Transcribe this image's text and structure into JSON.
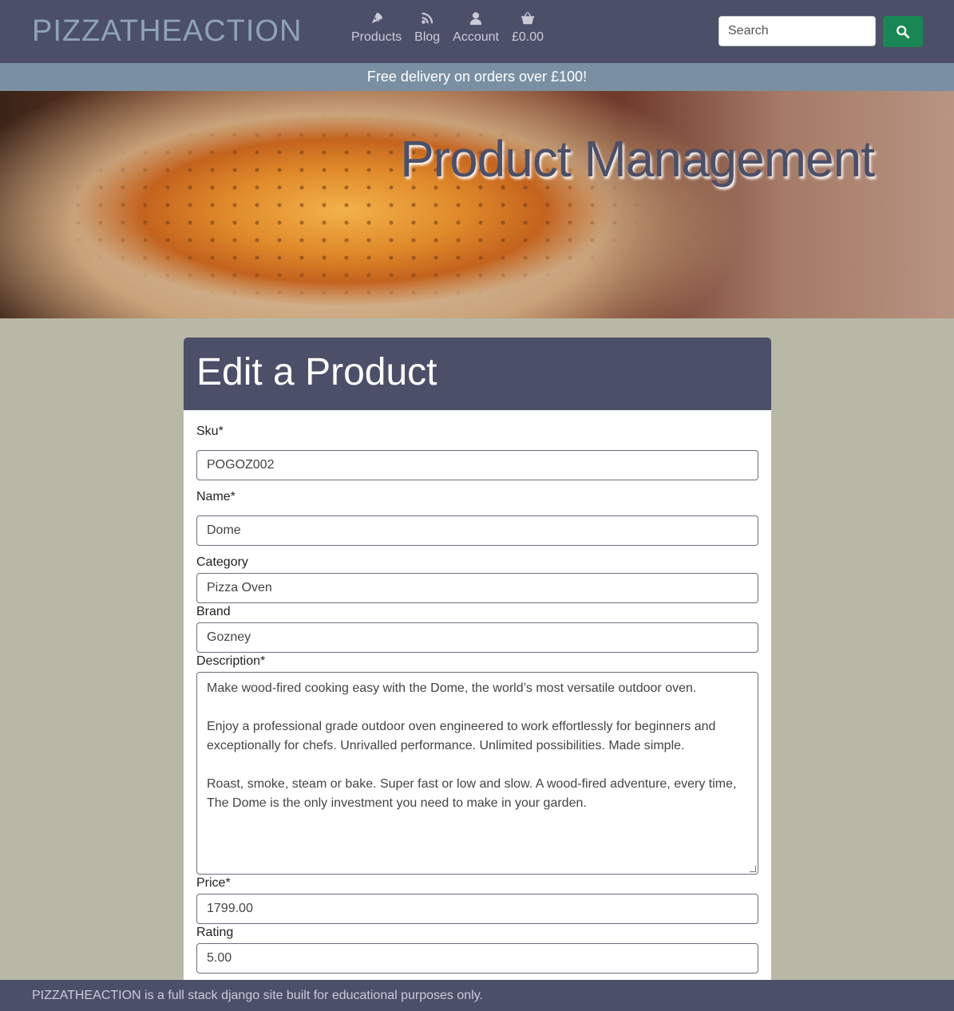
{
  "header": {
    "brand": "PIZZATHEACTION",
    "nav": [
      {
        "label": "Products",
        "icon": "pizza-slice-icon"
      },
      {
        "label": "Blog",
        "icon": "rss-icon"
      },
      {
        "label": "Account",
        "icon": "user-icon"
      },
      {
        "label": "£0.00",
        "icon": "basket-icon"
      }
    ],
    "search_placeholder": "Search",
    "search_button_color": "#198754"
  },
  "banner": {
    "text": "Free delivery on orders over £100!"
  },
  "hero": {
    "title": "Product Management"
  },
  "form": {
    "title": "Edit a Product",
    "sku": {
      "label": "Sku*",
      "value": "POGOZ002"
    },
    "name": {
      "label": "Name*",
      "value": "Dome"
    },
    "category": {
      "label": "Category",
      "value": "Pizza Oven"
    },
    "brand": {
      "label": "Brand",
      "value": "Gozney"
    },
    "description": {
      "label": "Description*",
      "paragraphs": [
        "Make wood-fired cooking easy with the Dome, the world’s most versatile outdoor oven.",
        "Enjoy a professional grade outdoor oven engineered to work effortlessly for beginners and exceptionally for chefs. Unrivalled performance. Unlimited possibilities. Made simple.",
        "Roast, smoke, steam or bake. Super fast or low and slow. A wood-fired adventure, every time, The Dome is the only investment you need to make in your garden."
      ]
    },
    "price": {
      "label": "Price*",
      "value": "1799.00"
    },
    "rating": {
      "label": "Rating",
      "value": "5.00"
    }
  },
  "footer": {
    "text": "PIZZATHEACTION is a full stack django site built for educational purposes only."
  },
  "colors": {
    "navbar": "#4c4f68",
    "banner": "#7a90a2",
    "page_bg": "#b8b8a7"
  }
}
